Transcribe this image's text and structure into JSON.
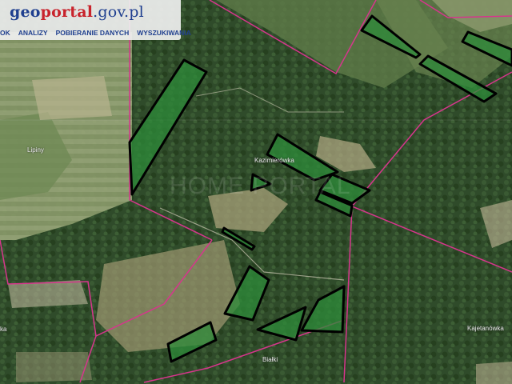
{
  "app": {
    "logo_geo": "geo",
    "logo_portal": "portal",
    "logo_domain": ".gov.pl"
  },
  "menu": {
    "items": [
      "OK",
      "ANALIZY",
      "POBIERANIE DANYCH",
      "WYSZUKIWANIA"
    ]
  },
  "places": {
    "lipiny": "Lipiny",
    "kazimierowka": "Kazimierówka",
    "kajetanowka": "Kajetanówka",
    "bialki": "Białki",
    "left_edge": "ka"
  },
  "watermark": "HOME PORTAL",
  "colors": {
    "parcel_fill": "#2e8b3a",
    "parcel_stroke": "#000000",
    "boundary": "#d6358c",
    "forest": "#2d4a28"
  }
}
